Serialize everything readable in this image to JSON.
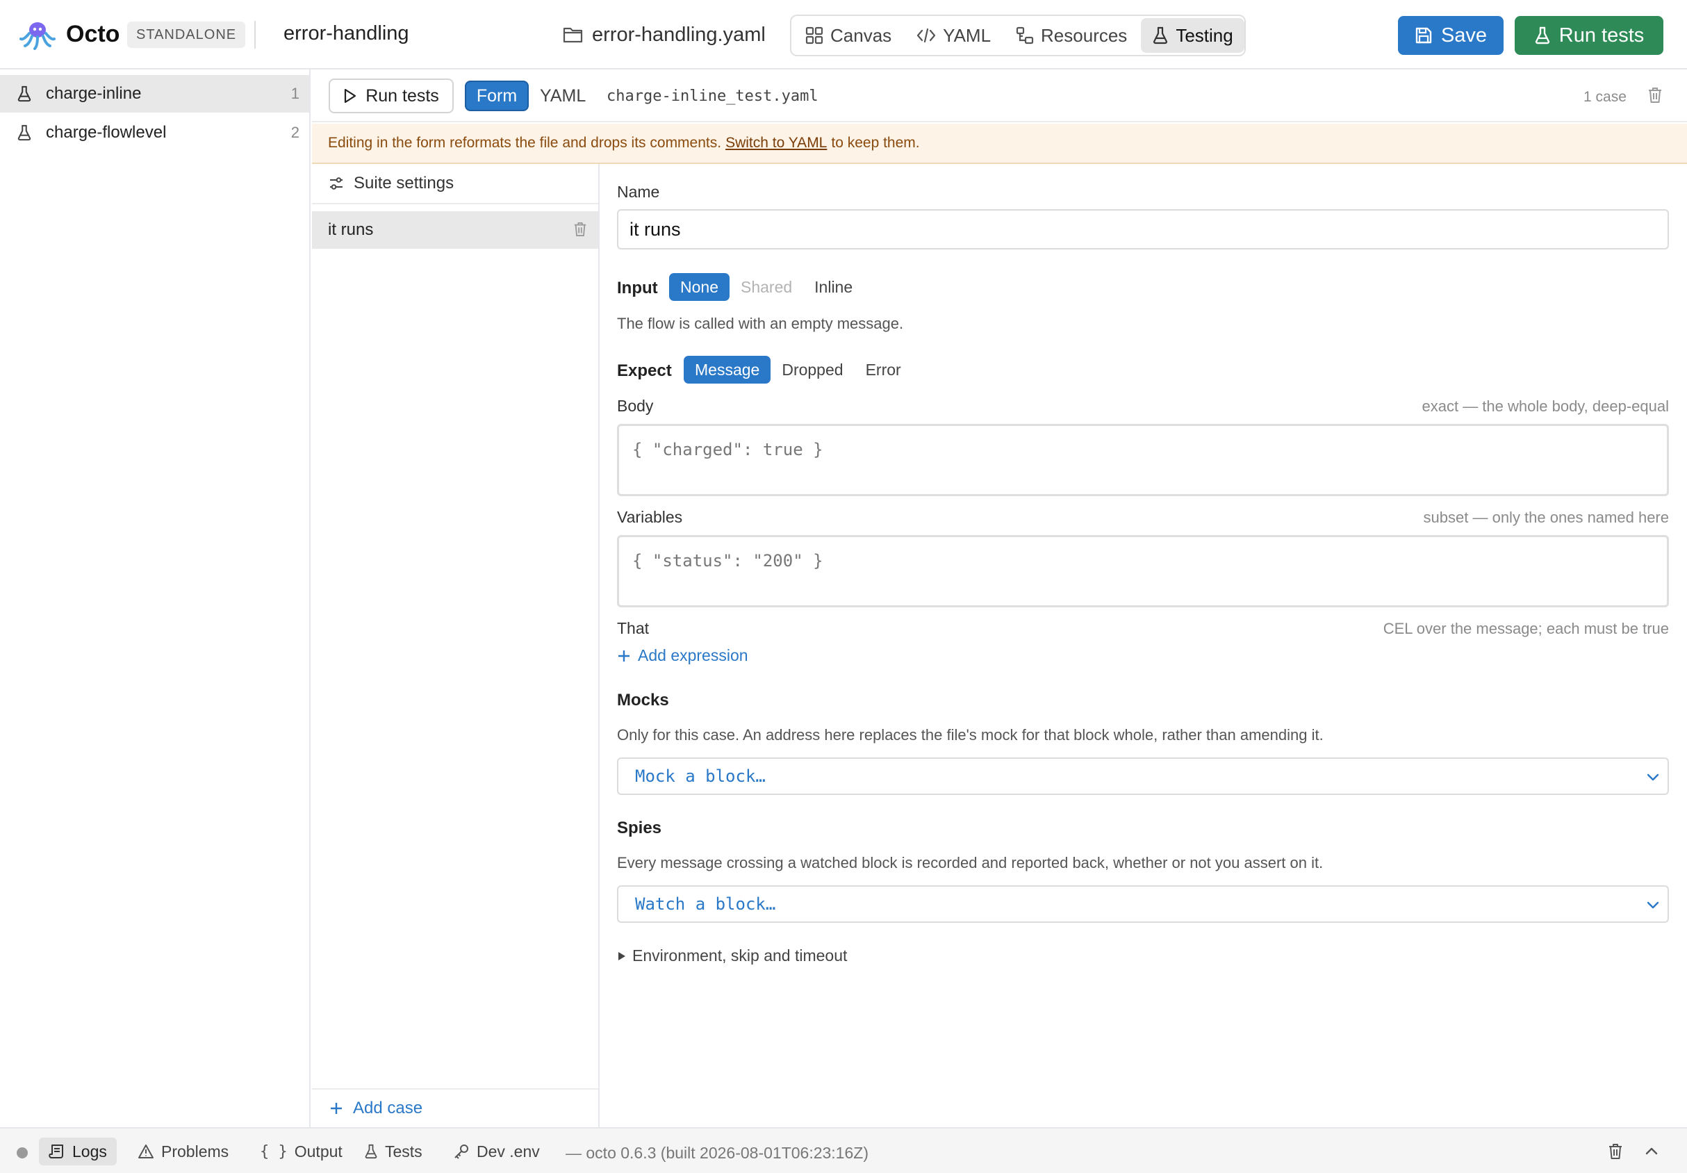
{
  "header": {
    "brand": "Octo",
    "mode_badge": "STANDALONE",
    "project": "error-handling",
    "file": "error-handling.yaml",
    "view_tabs": [
      {
        "label": "Canvas",
        "icon": "grid-icon"
      },
      {
        "label": "YAML",
        "icon": "code-icon"
      },
      {
        "label": "Resources",
        "icon": "resources-icon"
      },
      {
        "label": "Testing",
        "icon": "flask-icon",
        "active": true
      }
    ],
    "save_label": "Save",
    "run_tests_label": "Run tests"
  },
  "sidebar": {
    "items": [
      {
        "label": "charge-inline",
        "count": "1",
        "active": true
      },
      {
        "label": "charge-flowlevel",
        "count": "2",
        "active": false
      }
    ]
  },
  "toolbar": {
    "run_label": "Run tests",
    "mode_form": "Form",
    "mode_yaml": "YAML",
    "file": "charge-inline_test.yaml",
    "case_count": "1 case"
  },
  "banner": {
    "before": "Editing in the form reformats the file and drops its comments.",
    "link": "Switch to YAML",
    "after": "to keep them."
  },
  "cases": {
    "suite_settings": "Suite settings",
    "items": [
      "it runs"
    ],
    "add_case": "Add case"
  },
  "form": {
    "name_label": "Name",
    "name_value": "it runs",
    "input_label": "Input",
    "input_options": [
      "None",
      "Shared",
      "Inline"
    ],
    "input_selected": "None",
    "input_desc": "The flow is called with an empty message.",
    "expect_label": "Expect",
    "expect_options": [
      "Message",
      "Dropped",
      "Error"
    ],
    "expect_selected": "Message",
    "body_label": "Body",
    "body_hint": "exact — the whole body, deep-equal",
    "body_placeholder": "{ \"charged\": true }",
    "variables_label": "Variables",
    "variables_hint": "subset — only the ones named here",
    "variables_placeholder": "{ \"status\": \"200\" }",
    "that_label": "That",
    "that_hint": "CEL over the message; each must be true",
    "add_expression": "Add expression",
    "mocks_label": "Mocks",
    "mocks_desc": "Only for this case. An address here replaces the file's mock for that block whole, rather than amending it.",
    "mock_select": "Mock a block…",
    "spies_label": "Spies",
    "spies_desc": "Every message crossing a watched block is recorded and reported back, whether or not you assert on it.",
    "spy_select": "Watch a block…",
    "env_toggle": "Environment, skip and timeout"
  },
  "statusbar": {
    "tabs": [
      {
        "label": "Logs",
        "icon": "logs-icon",
        "active": true
      },
      {
        "label": "Problems",
        "icon": "warning-icon"
      },
      {
        "label": "Output",
        "icon": "braces-icon"
      },
      {
        "label": "Tests",
        "icon": "flask-icon"
      },
      {
        "label": "Dev .env",
        "icon": "key-icon"
      }
    ],
    "version": "— octo 0.6.3 (built 2026-08-01T06:23:16Z)"
  },
  "colors": {
    "accent": "#2a78c8",
    "run_green": "#2e8b57",
    "warning_bg": "#fdf3e6",
    "warning_text": "#8a4b0f"
  }
}
